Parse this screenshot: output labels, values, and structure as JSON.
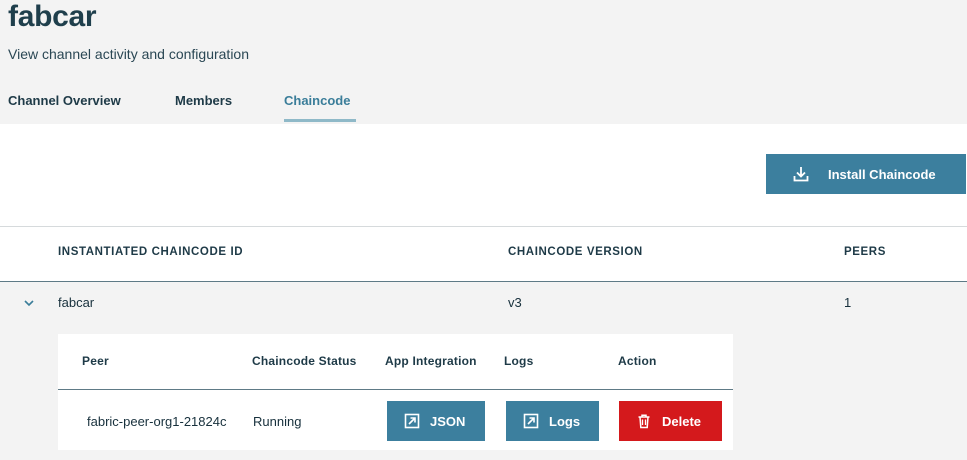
{
  "page": {
    "title": "fabcar",
    "subtitle": "View channel activity and configuration"
  },
  "tabs": [
    {
      "label": "Channel Overview",
      "active": false
    },
    {
      "label": "Members",
      "active": false
    },
    {
      "label": "Chaincode",
      "active": true
    }
  ],
  "toolbar": {
    "install_label": "Install Chaincode",
    "install_icon": "download-icon"
  },
  "table": {
    "headers": [
      "INSTANTIATED CHAINCODE ID",
      "CHAINCODE VERSION",
      "PEERS"
    ],
    "rows": [
      {
        "id": "fabcar",
        "version": "v3",
        "peers": "1",
        "expanded": true,
        "expand_icon": "chevron-down-icon"
      }
    ]
  },
  "details": {
    "headers": [
      "Peer",
      "Chaincode Status",
      "App Integration",
      "Logs",
      "Action"
    ],
    "rows": [
      {
        "peer": "fabric-peer-org1-21824c",
        "status": "Running",
        "json_label": "JSON",
        "logs_label": "Logs",
        "delete_label": "Delete",
        "json_icon": "launch-icon",
        "logs_icon": "launch-icon",
        "delete_icon": "trash-icon"
      }
    ]
  },
  "colors": {
    "primary": "#3c7f9e",
    "danger": "#d4191c",
    "active_tab": "#3a7d99",
    "header_bg": "#f3f3f3"
  }
}
